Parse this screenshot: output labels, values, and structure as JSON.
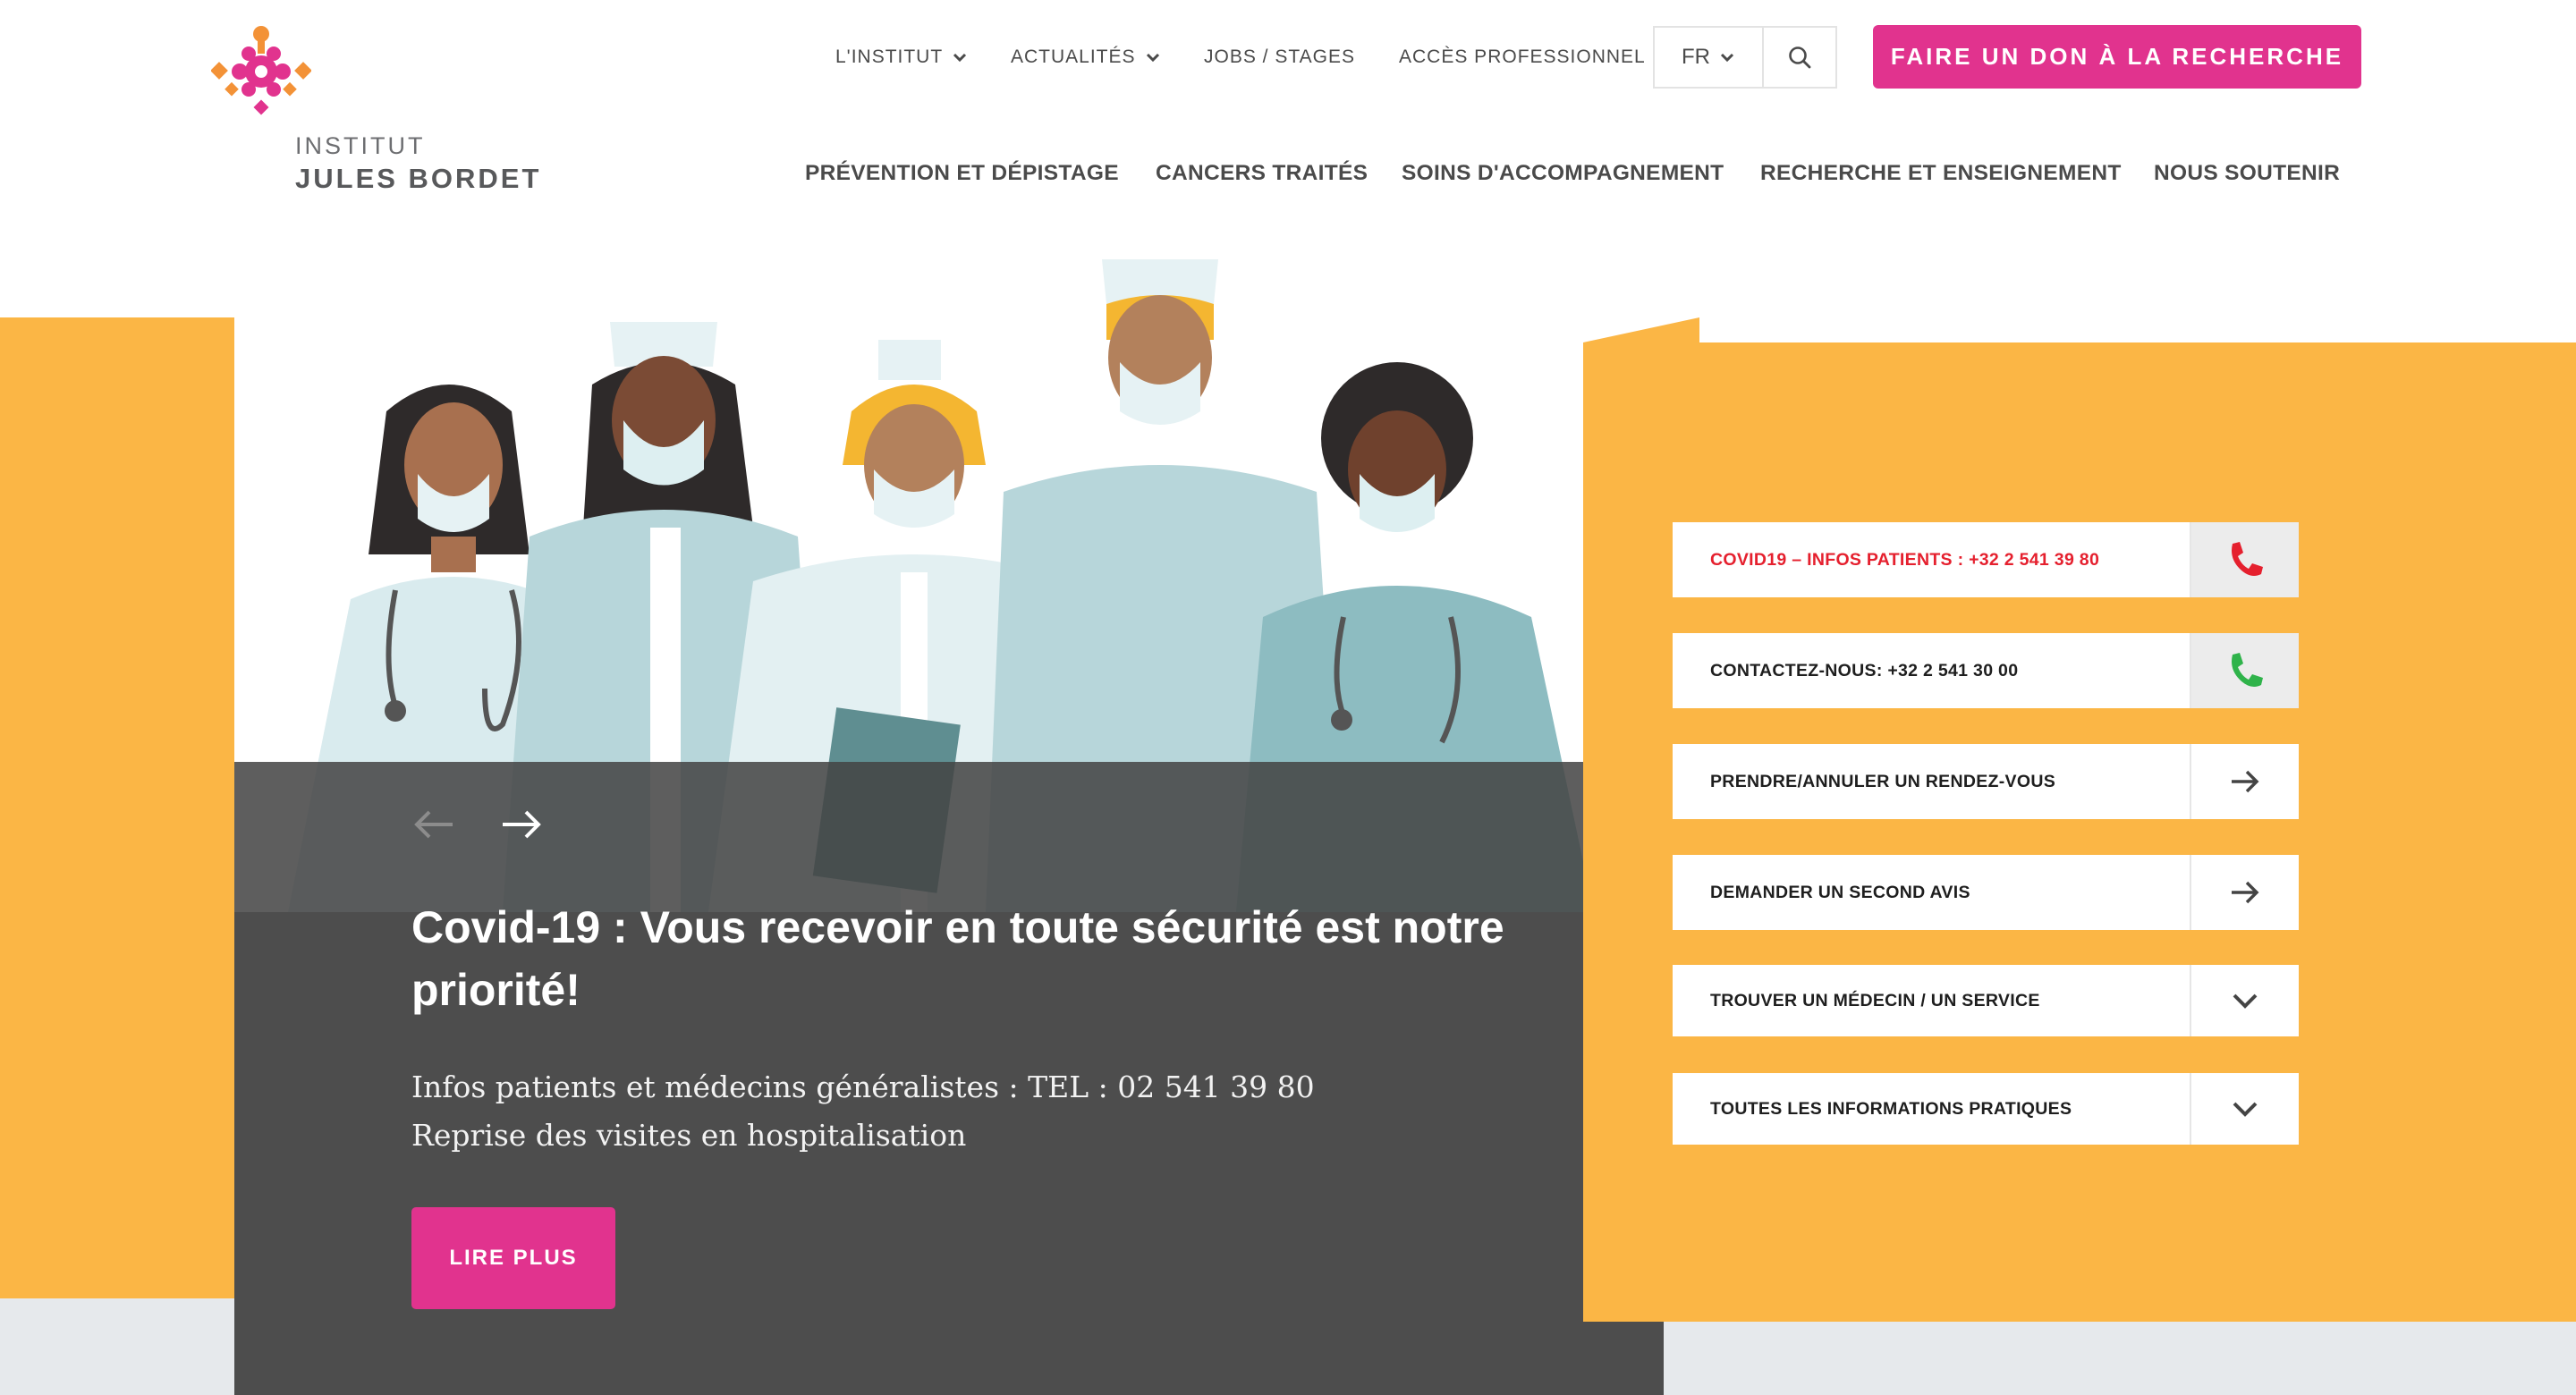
{
  "brand": {
    "line1": "INSTITUT",
    "line2": "JULES BORDET",
    "colors": {
      "orange": "#F39237",
      "pink": "#E1338E"
    }
  },
  "topnav": {
    "items": [
      {
        "label": "L'INSTITUT",
        "dropdown": true
      },
      {
        "label": "ACTUALITÉS",
        "dropdown": true
      },
      {
        "label": "JOBS / STAGES",
        "dropdown": false
      },
      {
        "label": "ACCÈS PROFESSIONNEL",
        "dropdown": false
      }
    ],
    "language": "FR",
    "search_icon": "search-icon",
    "donate_label": "FAIRE UN DON À LA RECHERCHE"
  },
  "mainnav": {
    "items": [
      "PRÉVENTION ET DÉPISTAGE",
      "CANCERS TRAITÉS",
      "SOINS D'ACCOMPAGNEMENT",
      "RECHERCHE ET ENSEIGNEMENT",
      "NOUS SOUTENIR"
    ]
  },
  "hero": {
    "title": "Covid-19 : Vous recevoir en toute sécurité est notre priorité!",
    "line1": "Infos patients et médecins généralistes : TEL : 02 541 39 80",
    "line2": "Reprise des visites en hospitalisation",
    "cta": "LIRE PLUS",
    "prev_icon": "arrow-left-icon",
    "next_icon": "arrow-right-icon"
  },
  "quick_links": [
    {
      "label": "COVID19 – INFOS PATIENTS : +32 2 541 39 80",
      "icon": "phone-icon",
      "color": "#E5202E"
    },
    {
      "label": "CONTACTEZ-NOUS: +32 2 541 30 00",
      "icon": "phone-icon",
      "color": "#2FB34A"
    },
    {
      "label": "PRENDRE/ANNULER UN RENDEZ-VOUS",
      "icon": "arrow-right-icon"
    },
    {
      "label": "DEMANDER UN SECOND AVIS",
      "icon": "arrow-right-icon"
    },
    {
      "label": "TROUVER UN MÉDECIN / UN SERVICE",
      "icon": "chevron-down-icon"
    },
    {
      "label": "TOUTES LES INFORMATIONS PRATIQUES",
      "icon": "chevron-down-icon"
    }
  ]
}
